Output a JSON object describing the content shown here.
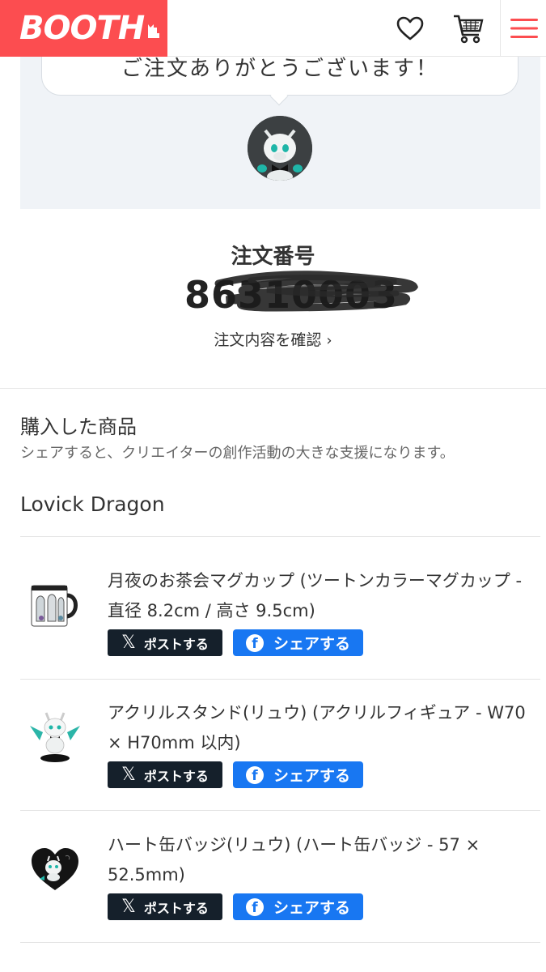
{
  "header": {
    "logo": "BOOTH",
    "icons": [
      "heart-icon",
      "cart-icon",
      "menu-icon"
    ],
    "brand_color": "#fc4d50"
  },
  "thanks": {
    "message": "ご注文ありがとうございます！"
  },
  "order": {
    "label": "注文番号",
    "number": "86310003",
    "details_link": "注文内容を確認"
  },
  "purchased": {
    "title": "購入した商品",
    "subtitle": "シェアすると、クリエイターの創作活動の大きな支援になります。",
    "shop_name": "Lovick Dragon",
    "items": [
      {
        "title": "月夜のお茶会マグカップ (ツートンカラーマグカップ - 直径 8.2cm / 高さ 9.5cm)",
        "post_label": "ポストする",
        "share_label": "シェアする"
      },
      {
        "title": "アクリルスタンド(リュウ) (アクリルフィギュア - W70 × H70mm 以内)",
        "post_label": "ポストする",
        "share_label": "シェアする"
      },
      {
        "title": "ハート缶バッジ(リュウ) (ハート缶バッジ - 57 × 52.5mm)",
        "post_label": "ポストする",
        "share_label": "シェアする"
      }
    ]
  },
  "colors": {
    "x_button": "#15202b",
    "facebook_button": "#1877f2",
    "panel_bg": "#f0f3f7"
  }
}
